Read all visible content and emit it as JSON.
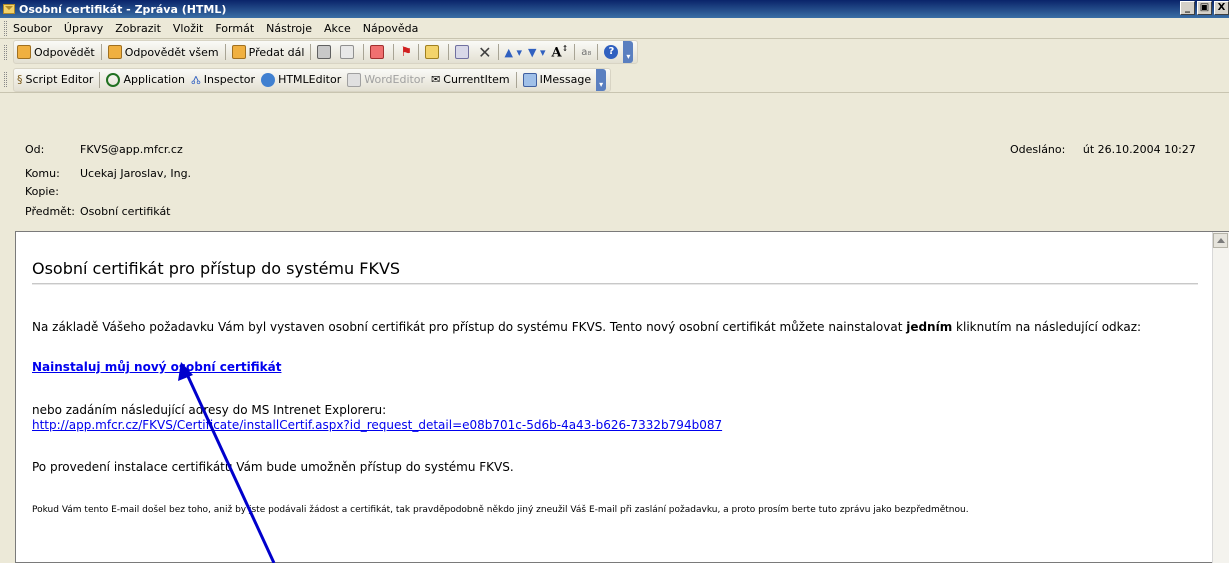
{
  "window": {
    "title": "Osobní certifikát - Zpráva (HTML)",
    "minimize": "_",
    "maximize": "!",
    "close": "X"
  },
  "menu": [
    "Soubor",
    "Úpravy",
    "Zobrazit",
    "Vložit",
    "Formát",
    "Nástroje",
    "Akce",
    "Nápověda"
  ],
  "toolbar1": {
    "reply": "Odpovědět",
    "reply_all": "Odpovědět všem",
    "forward": "Předat dál"
  },
  "toolbar2": {
    "script_editor": "Script Editor",
    "application": "Application",
    "inspector": "Inspector",
    "html_editor": "HTMLEditor",
    "word_editor": "WordEditor",
    "current_item": "CurrentItem",
    "imessage": "IMessage"
  },
  "header": {
    "from_label": "Od:",
    "from": "FKVS@app.mfcr.cz",
    "to_label": "Komu:",
    "to": "Ucekaj Jaroslav, Ing.",
    "cc_label": "Kopie:",
    "cc": "",
    "subject_label": "Předmět:",
    "subject": "Osobní certifikát",
    "sent_label": "Odesláno:",
    "sent": "út 26.10.2004 10:27"
  },
  "message": {
    "title": "Osobní certifikát pro přístup do systému FKVS",
    "p1_before": "Na základě Vášeho požadavku Vám byl vystaven osobní certifikát pro přístup do systému FKVS. Tento nový osobní certifikát můžete nainstalovat ",
    "p1_bold": "jedním",
    "p1_after": " kliknutím na následující odkaz:",
    "install_link": "Nainstaluj můj nový osobní certifikát",
    "p2": "nebo zadáním následující adresy do MS Intrenet Exploreru:",
    "url": "http://app.mfcr.cz/FKVS/Certificate/installCertif.aspx?id_request_detail=e08b701c-5d6b-4a43-b626-7332b794b087",
    "p3": "Po provedení instalace certifikátu Vám bude umožněn přístup do systému FKVS.",
    "p4": "Pokud Vám tento E-mail došel bez toho, aniž by jste podávali žádost a certifikát, tak pravděpodobně někdo jiný zneužil Váš E-mail při zaslání požadavku, a proto prosím berte tuto zprávu jako bezpředmětnou."
  },
  "colors": {
    "titlebar": "#0a246a",
    "link": "#0000ee",
    "annotation_arrow": "#0000cc"
  }
}
